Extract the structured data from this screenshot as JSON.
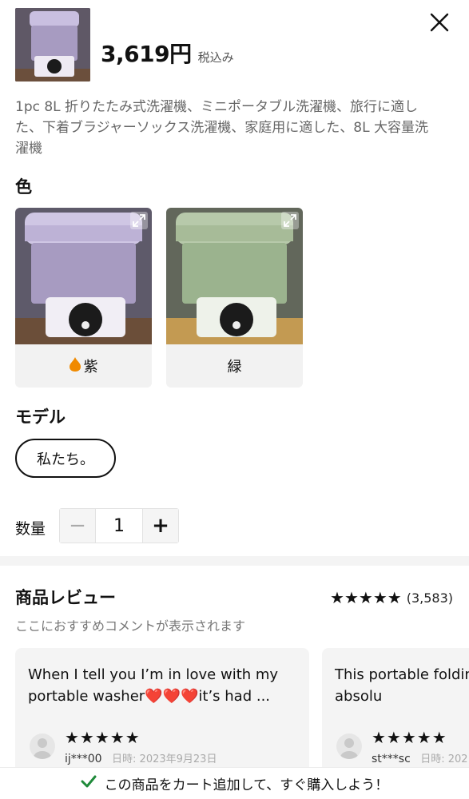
{
  "header": {
    "price": "3,619円",
    "tax_label": "税込み",
    "description": "1pc 8L 折りたたみ式洗濯機、ミニポータブル洗濯機、旅行に適した、下着ブラジャーソックス洗濯機、家庭用に適した、8L 大容量洗濯機"
  },
  "color": {
    "label": "色",
    "options": [
      {
        "name": "紫",
        "hot": true,
        "body_color": "#a79bc1"
      },
      {
        "name": "緑",
        "hot": false,
        "body_color": "#9bb38e"
      }
    ]
  },
  "model": {
    "label": "モデル",
    "options": [
      "私たち。"
    ]
  },
  "quantity": {
    "label": "数量",
    "value": "1",
    "minus": "−",
    "plus": "+"
  },
  "reviews": {
    "title": "商品レビュー",
    "stars": "★★★★★",
    "count": "(3,583)",
    "subtitle": "ここにおすすめコメントが表示されます",
    "items": [
      {
        "text": "When I tell you I’m in love with my portable washer❤️❤️❤️it’s had ...",
        "stars": "★★★★★",
        "user": "ij***00",
        "date": "日時: 2023年9月23日"
      },
      {
        "text": "This portable folding machine is absolu",
        "stars": "★★★★★",
        "user": "st***sc",
        "date": "日時: 202"
      }
    ]
  },
  "cart_banner": {
    "text": "この商品をカート追加して、すぐ購入しよう！"
  },
  "colors": {
    "accent_orange": "#f08a00",
    "check_green": "#1f8a3a",
    "text_primary": "#111111",
    "text_secondary": "#666666"
  }
}
